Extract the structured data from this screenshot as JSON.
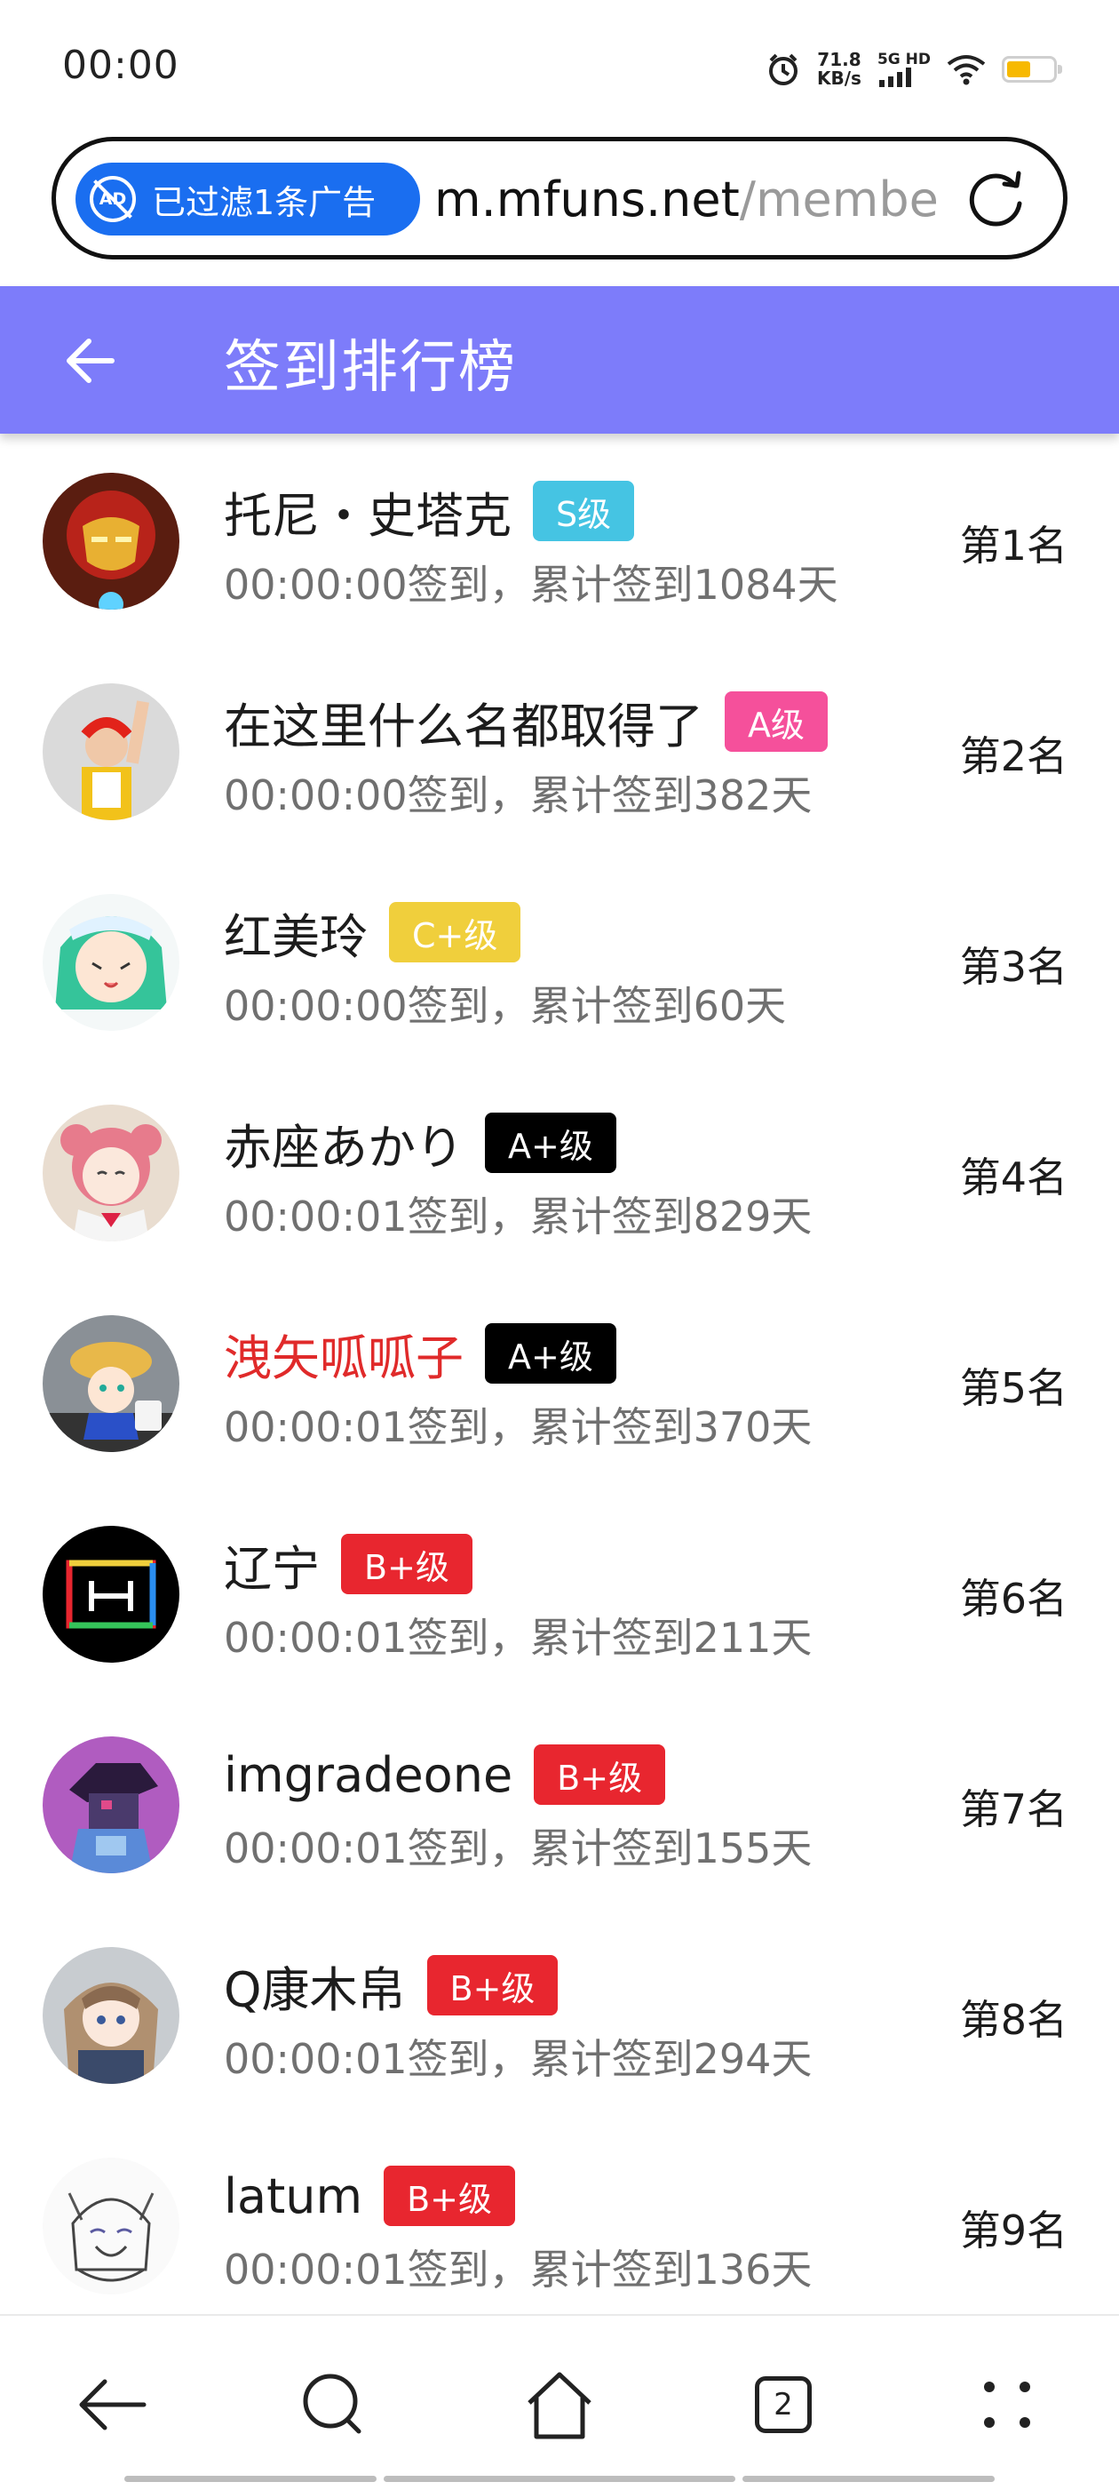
{
  "status": {
    "time": "00:00",
    "net_speed_value": "71.8",
    "net_speed_unit": "KB/s",
    "network_type": "5G HD",
    "icons": [
      "alarm-icon",
      "signal-icon",
      "wifi-icon",
      "battery-icon"
    ]
  },
  "browser": {
    "ad_filter": "已过滤1条广告",
    "url_host": "m.mfuns.net",
    "url_path": "/membe"
  },
  "header": {
    "title": "签到排行榜",
    "color": "#7d7cfa"
  },
  "rows": [
    {
      "name": "托尼・史塔克",
      "badge": "S级",
      "badge_color": "#45c4e3",
      "sub": "00:00:00签到，累计签到1084天",
      "rank": "第1名",
      "name_red": false
    },
    {
      "name": "在这里什么名都取得了",
      "badge": "A级",
      "badge_color": "#f5509b",
      "sub": "00:00:00签到，累计签到382天",
      "rank": "第2名",
      "name_red": false
    },
    {
      "name": "红美玲",
      "badge": "C+级",
      "badge_color": "#f0cf3c",
      "sub": "00:00:00签到，累计签到60天",
      "rank": "第3名",
      "name_red": false
    },
    {
      "name": "赤座あかり",
      "badge": "A+级",
      "badge_color": "#000000",
      "sub": "00:00:01签到，累计签到829天",
      "rank": "第4名",
      "name_red": false
    },
    {
      "name": "洩矢呱呱子",
      "badge": "A+级",
      "badge_color": "#000000",
      "sub": "00:00:01签到，累计签到370天",
      "rank": "第5名",
      "name_red": true
    },
    {
      "name": "辽宁",
      "badge": "B+级",
      "badge_color": "#e8262f",
      "sub": "00:00:01签到，累计签到211天",
      "rank": "第6名",
      "name_red": false
    },
    {
      "name": "imgradeone",
      "badge": "B+级",
      "badge_color": "#e8262f",
      "sub": "00:00:01签到，累计签到155天",
      "rank": "第7名",
      "name_red": false
    },
    {
      "name": "Q康木帛",
      "badge": "B+级",
      "badge_color": "#e8262f",
      "sub": "00:00:01签到，累计签到294天",
      "rank": "第8名",
      "name_red": false
    },
    {
      "name": "latum",
      "badge": "B+级",
      "badge_color": "#e8262f",
      "sub": "00:00:01签到，累计签到136天",
      "rank": "第9名",
      "name_red": false
    }
  ],
  "bottom_nav": {
    "tab_count": "2",
    "icons": [
      "back-icon",
      "search-icon",
      "home-icon",
      "tabs-icon",
      "menu-icon"
    ]
  }
}
